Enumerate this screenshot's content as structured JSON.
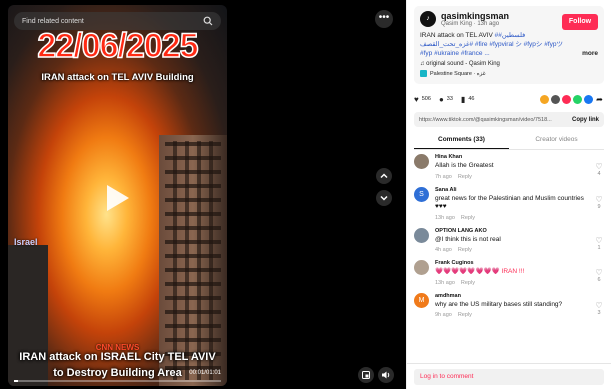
{
  "video": {
    "search_placeholder": "Find related content",
    "date_overlay": "22/06/2025",
    "headline_overlay": "IRAN attack on TEL AVIV Building",
    "israel_tag": "Israel",
    "cnn_label": "CNN NEWS",
    "caption_line1": "IRAN attack on ISRAEL City TEL AVIV",
    "caption_line2": "to Destroy Building Area",
    "timecode": "00:01/01:01",
    "progress": 0.02
  },
  "author": {
    "username": "qasimkingsman",
    "display_meta": "Qasim King · 13h ago",
    "follow_label": "Follow",
    "description": "IRAN attack on TEL AVIV",
    "hashtags": "#فلسطين# غزه_تحت_القصف# #fire #fypviral シ #fypシ #fypツ #fyp #ukraine #france ...",
    "more_label": "more",
    "sound": "original sound - Qasim King",
    "place": "Palestine Square · غزه"
  },
  "stats": {
    "likes": "506",
    "comments": "33",
    "saves": "46"
  },
  "link": {
    "url": "https://www.tiktok.com/@qasimkingsman/video/7518...",
    "copy_label": "Copy link"
  },
  "tabs": [
    {
      "label": "Comments (33)"
    },
    {
      "label": "Creator videos"
    }
  ],
  "comments": [
    {
      "user": "Hina Khan",
      "text": "Allah is the Greatest",
      "time": "7h ago",
      "reply": "Reply",
      "likes": "4",
      "avatar_color": "#8a7a6a",
      "initial": ""
    },
    {
      "user": "Sana Ali",
      "text": "great news for the Palestinian and Muslim countries ♥♥♥",
      "time": "13h ago",
      "reply": "Reply",
      "likes": "9",
      "avatar_color": "#2f6fd6",
      "initial": "S"
    },
    {
      "user": "OPTION LANG AKO",
      "text": "@I think this is not real",
      "time": "4h ago",
      "reply": "Reply",
      "likes": "1",
      "avatar_color": "#7a8a9a",
      "initial": ""
    },
    {
      "user": "Frank Cuginos",
      "text": "💗💗💗💗💗💗💗💗 IRAN !!!",
      "time": "13h ago",
      "reply": "Reply",
      "likes": "6",
      "avatar_color": "#b0a090",
      "initial": ""
    },
    {
      "user": "amdhman",
      "text": "why are the US military bases still standing?",
      "time": "9h ago",
      "reply": "Reply",
      "likes": "3",
      "avatar_color": "#f07a1a",
      "initial": "M"
    }
  ],
  "login": {
    "label": "Log in to comment"
  }
}
